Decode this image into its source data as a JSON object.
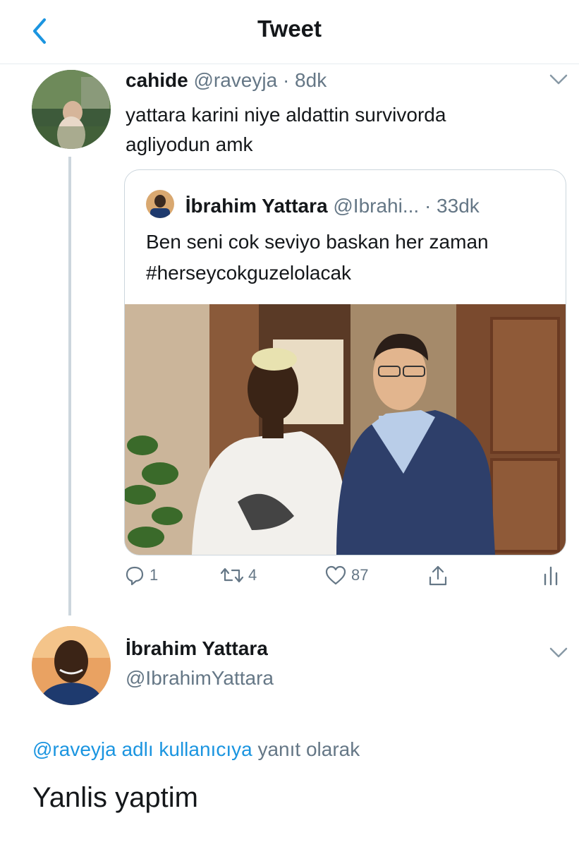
{
  "header": {
    "title": "Tweet"
  },
  "tweet": {
    "author_name": "cahide",
    "author_handle": "@raveyja",
    "time": "· 8dk",
    "text": "yattara karini niye aldattin survivorda agliyodun amk"
  },
  "quoted": {
    "author_name": "İbrahim Yattara",
    "author_handle": "@Ibrahi...",
    "time": "· 33dk",
    "text": "Ben seni cok seviyo baskan her zaman #herseycokguzelolacak"
  },
  "actions": {
    "reply_count": "1",
    "retweet_count": "4",
    "like_count": "87"
  },
  "reply": {
    "author_name": "İbrahim Yattara",
    "author_handle": "@IbrahimYattara",
    "replying_link": "@raveyja adlı kullanıcıya",
    "replying_suffix": " yanıt olarak",
    "text": "Yanlis yaptim"
  },
  "colors": {
    "accent": "#1b95e0",
    "muted": "#657786",
    "border": "#e6ecf0"
  },
  "icons": [
    "back-arrow-icon",
    "chevron-down-icon",
    "reply-icon",
    "retweet-icon",
    "like-icon",
    "share-icon",
    "analytics-icon"
  ]
}
